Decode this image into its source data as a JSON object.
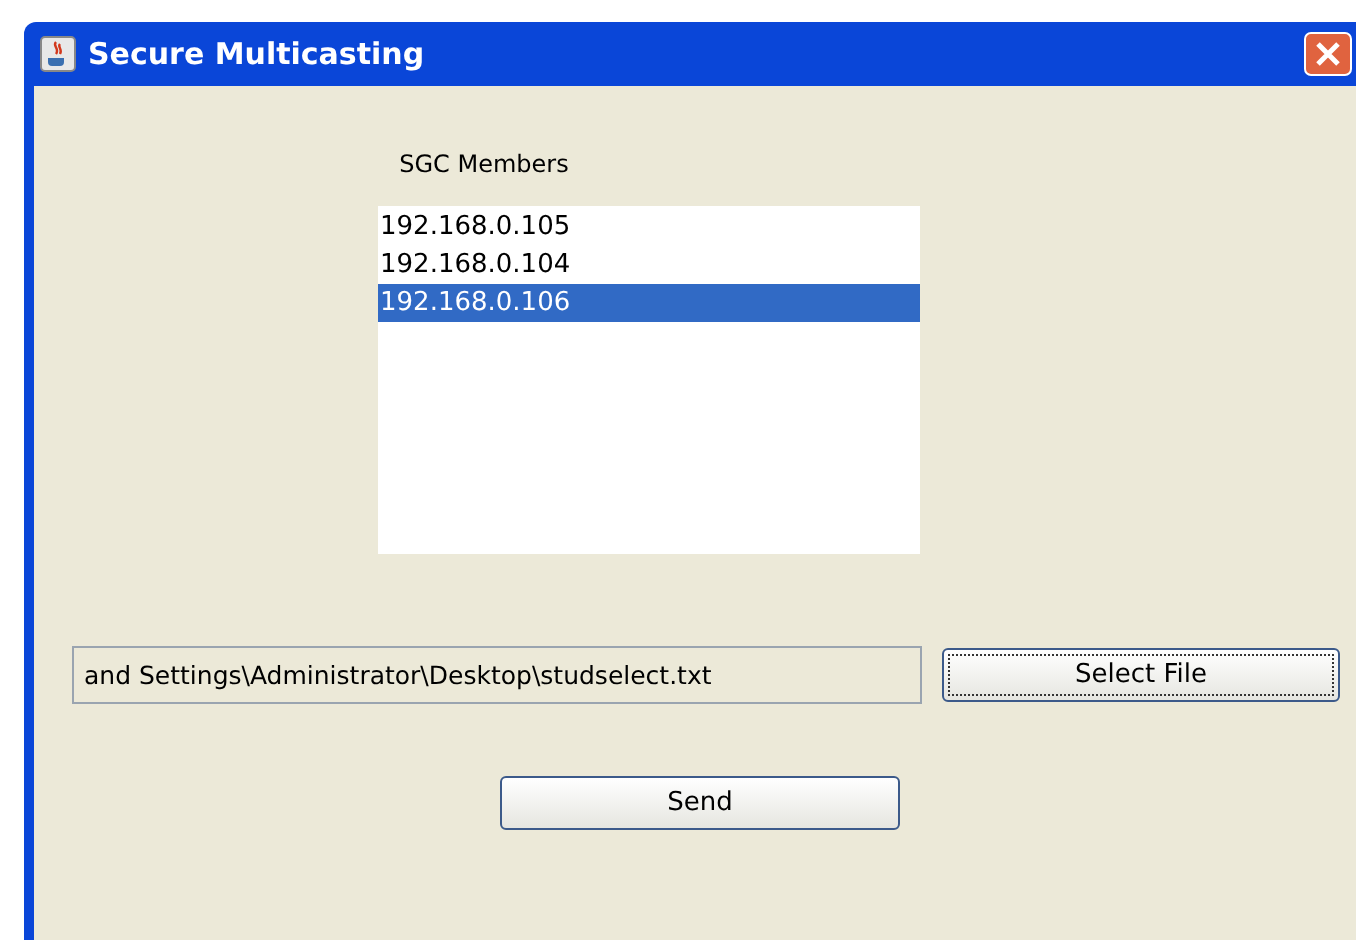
{
  "window": {
    "title": "Secure Multicasting"
  },
  "members": {
    "label": "SGC Members",
    "items": [
      {
        "address": "192.168.0.105",
        "selected": false
      },
      {
        "address": "192.168.0.104",
        "selected": false
      },
      {
        "address": "192.168.0.106",
        "selected": true
      }
    ]
  },
  "file_field": {
    "value": "and Settings\\Administrator\\Desktop\\studselect.txt"
  },
  "buttons": [
    {
      "label": "Select File",
      "focused": true
    },
    {
      "label": "Send",
      "focused": false
    }
  ]
}
